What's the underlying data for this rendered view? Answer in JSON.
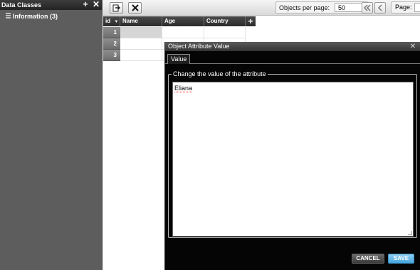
{
  "sidebar": {
    "title": "Data Classes",
    "add_label": "+",
    "close_label": "✕",
    "items": [
      {
        "label": "Information (3)"
      }
    ]
  },
  "toolbar": {
    "objects_per_page_label": "Objects per page:",
    "objects_per_page_value": "50",
    "page_label": "Page:"
  },
  "grid": {
    "columns": [
      "id",
      "Name",
      "Age",
      "Country"
    ],
    "add_column_label": "+",
    "rows": [
      {
        "id": "1"
      },
      {
        "id": "2"
      },
      {
        "id": "3"
      }
    ]
  },
  "dialog": {
    "title": "Object Attribute Value",
    "close_label": "✕",
    "tab": "Value",
    "legend": "Change the value of the attribute",
    "value": "Eliana",
    "cancel_label": "CANCEL",
    "save_label": "SAVE"
  }
}
